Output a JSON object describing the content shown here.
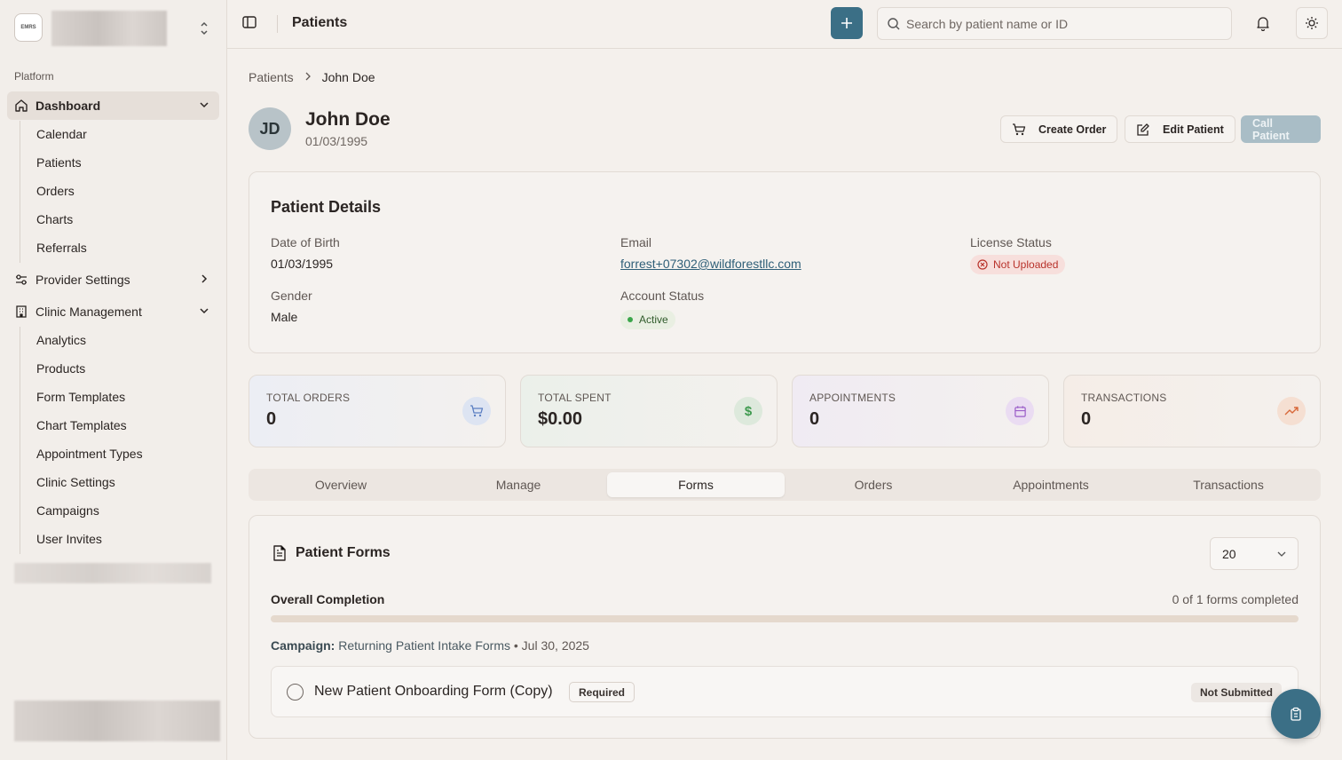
{
  "org": {
    "logo_text": "EMRS"
  },
  "sidebar": {
    "section_label": "Platform",
    "dashboard": {
      "label": "Dashboard",
      "children": [
        "Calendar",
        "Patients",
        "Orders",
        "Charts",
        "Referrals"
      ]
    },
    "provider_settings": {
      "label": "Provider Settings"
    },
    "clinic_management": {
      "label": "Clinic Management",
      "children": [
        "Analytics",
        "Products",
        "Form Templates",
        "Chart Templates",
        "Appointment Types",
        "Clinic Settings",
        "Campaigns",
        "User Invites"
      ]
    }
  },
  "topbar": {
    "title": "Patients",
    "search_placeholder": "Search by patient name or ID"
  },
  "breadcrumb": {
    "parent": "Patients",
    "current": "John Doe"
  },
  "patient": {
    "initials": "JD",
    "name": "John Doe",
    "dob": "01/03/1995"
  },
  "actions": {
    "create_order": "Create Order",
    "edit_patient": "Edit Patient",
    "call_patient": "Call Patient"
  },
  "details": {
    "title": "Patient Details",
    "dob_label": "Date of Birth",
    "dob_value": "01/03/1995",
    "email_label": "Email",
    "email_value": "forrest+07302@wildforestllc.com",
    "license_label": "License Status",
    "license_value": "Not Uploaded",
    "gender_label": "Gender",
    "gender_value": "Male",
    "account_label": "Account Status",
    "account_value": "Active"
  },
  "stats": [
    {
      "label": "TOTAL ORDERS",
      "value": "0",
      "icon": "cart-icon",
      "color": "#5b7fc2"
    },
    {
      "label": "TOTAL SPENT",
      "value": "$0.00",
      "icon": "dollar-icon",
      "color": "#3f9a4f"
    },
    {
      "label": "APPOINTMENTS",
      "value": "0",
      "icon": "calendar-icon",
      "color": "#9a5cc8"
    },
    {
      "label": "TRANSACTIONS",
      "value": "0",
      "icon": "trending-up-icon",
      "color": "#d8683a"
    }
  ],
  "tabs": [
    "Overview",
    "Manage",
    "Forms",
    "Orders",
    "Appointments",
    "Transactions"
  ],
  "active_tab": "Forms",
  "forms": {
    "title": "Patient Forms",
    "page_size": "20",
    "completion_label": "Overall Completion",
    "completion_count": "0 of 1 forms completed",
    "completion_fraction": 0,
    "campaign_label": "Campaign:",
    "campaign_name": "Returning Patient Intake Forms",
    "campaign_date": "• Jul 30, 2025",
    "items": [
      {
        "name": "New Patient Onboarding Form (Copy)",
        "required_label": "Required",
        "status": "Not Submitted"
      }
    ]
  },
  "colors": {
    "primary": "#3b6f86",
    "danger": "#b8322a",
    "success": "#3aa64a"
  }
}
